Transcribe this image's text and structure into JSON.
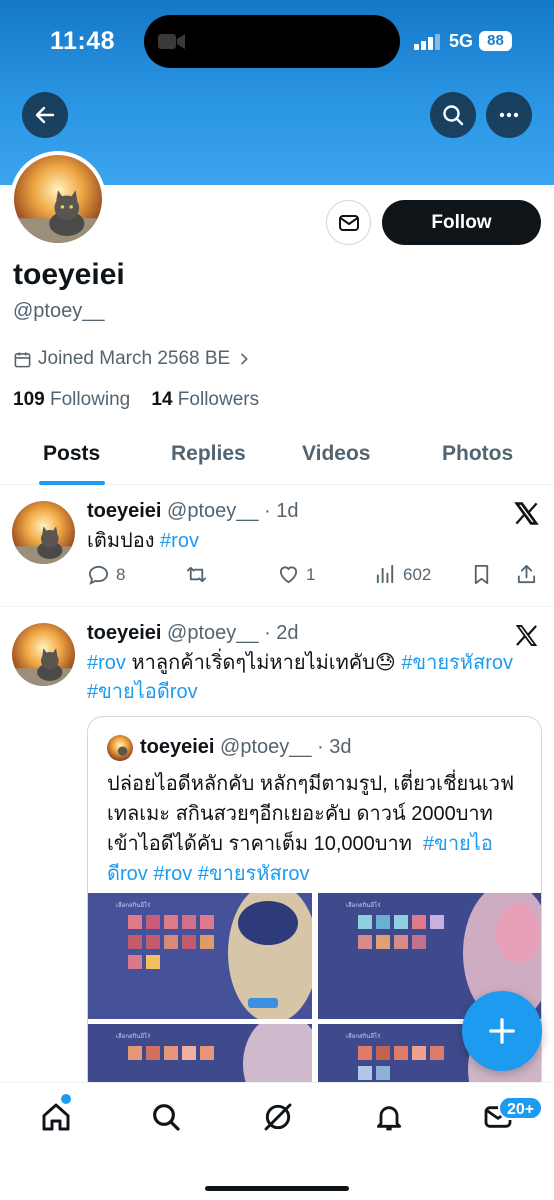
{
  "status_bar": {
    "time": "11:48",
    "network": "5G",
    "battery": "88"
  },
  "profile": {
    "name": "toeyeiei",
    "handle": "@ptoey__",
    "joined": "Joined March 2568 BE",
    "following_count": "109",
    "following_label": "Following",
    "followers_count": "14",
    "followers_label": "Followers",
    "follow_button": "Follow"
  },
  "tabs": [
    "Posts",
    "Replies",
    "Videos",
    "Photos"
  ],
  "posts": [
    {
      "name": "toeyeiei",
      "handle": "@ptoey__",
      "time": "· 1d",
      "text": "เติมปอง",
      "tag": "#rov",
      "replies": "8",
      "retweets": "",
      "likes": "1",
      "views": "602"
    },
    {
      "name": "toeyeiei",
      "handle": "@ptoey__",
      "time": "· 2d",
      "tag1": "#rov",
      "text": "หาลูกค้าเริ่ดๆไม่หายไม่เทคับ",
      "emoji": "😓",
      "tag2": "#ขายรหัสrov",
      "tag3": "#ขายไอดีrov",
      "quote": {
        "name": "toeyeiei",
        "handle": "@ptoey__",
        "time": "· 3d",
        "line1": "ปล่อยไอดีหลักคับ หลักๆมีตามรูป, เตี่ยวเชี่ยนเวฟ",
        "line2": "เทลเมะ สกินสวยๆอีกเยอะคับ ดาวน์ 2000บาท",
        "line3": "เข้าไอดีได้คับ ราคาเต็ม 10,000บาท",
        "tag_a": "#ขายไอ",
        "tag_b": "ดีrov",
        "tag_c": "#rov",
        "tag_d": "#ขายรหัสrov",
        "media_label": "เลือกสกินฮีโร่"
      }
    }
  ],
  "bottom_nav": {
    "messages_badge": "20+"
  }
}
